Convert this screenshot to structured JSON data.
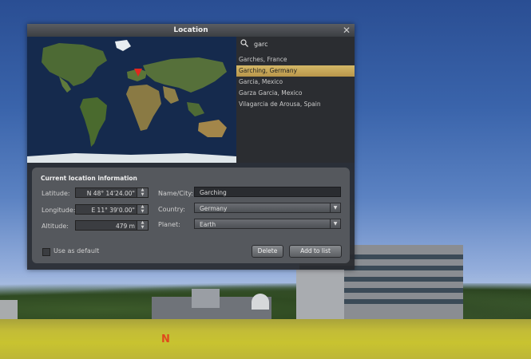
{
  "dialog": {
    "title": "Location",
    "close_label": "✕"
  },
  "search": {
    "value": "garc",
    "placeholder": ""
  },
  "results": [
    {
      "label": "Garches, France",
      "selected": false
    },
    {
      "label": "Garching, Germany",
      "selected": true
    },
    {
      "label": "Garcia, Mexico",
      "selected": false
    },
    {
      "label": "Garza Garcia, Mexico",
      "selected": false
    },
    {
      "label": "Vilagarcia de Arousa, Spain",
      "selected": false
    }
  ],
  "info": {
    "section_title": "Current location information",
    "latitude": {
      "label": "Latitude:",
      "value": "N 48° 14'24.00\""
    },
    "longitude": {
      "label": "Longitude:",
      "value": "E 11° 39'0.00\""
    },
    "altitude": {
      "label": "Altitude:",
      "value": "479 m"
    },
    "name_city": {
      "label": "Name/City:",
      "value": "Garching"
    },
    "country": {
      "label": "Country:",
      "value": "Germany"
    },
    "planet": {
      "label": "Planet:",
      "value": "Earth"
    },
    "use_default": {
      "label": "Use as default",
      "checked": false
    },
    "delete_label": "Delete",
    "add_label": "Add to list"
  },
  "scene": {
    "compass_label": "N"
  },
  "colors": {
    "accent_selected": "#c9a85a",
    "marker": "#e0281f"
  }
}
